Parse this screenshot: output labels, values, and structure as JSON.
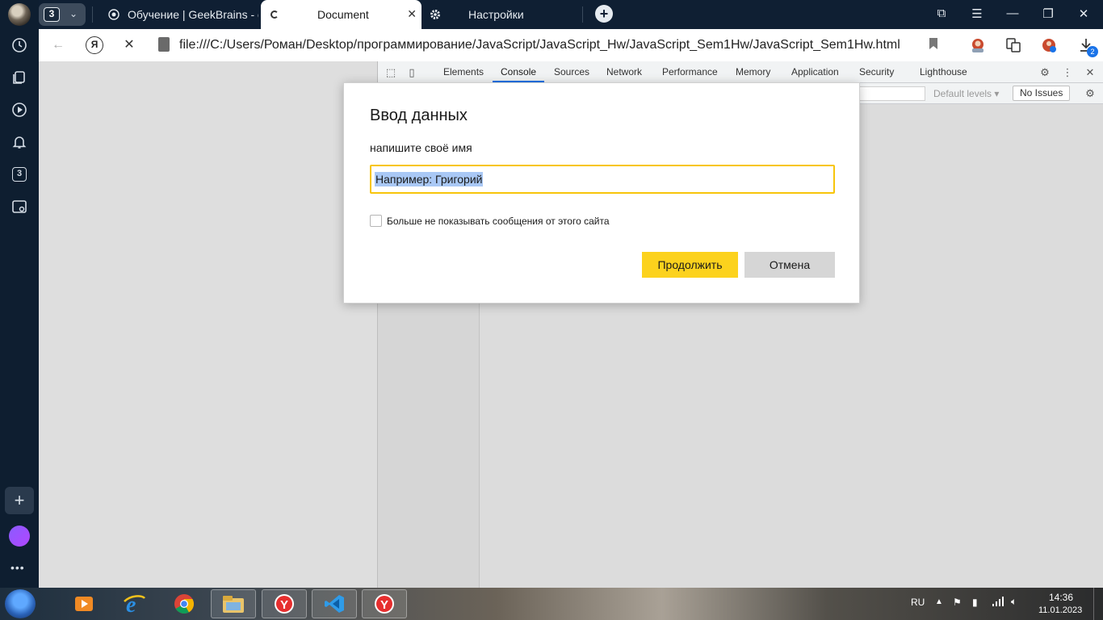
{
  "tabs": {
    "group_count": "3",
    "items": [
      {
        "label": "Обучение | GeekBrains - о"
      },
      {
        "label": "Document"
      },
      {
        "label": "Настройки"
      }
    ]
  },
  "address": {
    "url": "file:///C:/Users/Роман/Desktop/программирование/JavaScript/JavaScript_Hw/JavaScript_Sem1Hw/JavaScript_Sem1Hw.html",
    "yandex_button": "Я",
    "downloads_badge": "2"
  },
  "sidebar": {
    "counter_badge": "3"
  },
  "devtools": {
    "tabs": [
      "Elements",
      "Console",
      "Sources",
      "Network",
      "Performance",
      "Memory",
      "Application",
      "Security",
      "Lighthouse"
    ],
    "active_tab": "Console",
    "levels_label": "Default levels ▾",
    "issues_label": "No Issues"
  },
  "dialog": {
    "title": "Ввод данных",
    "message": "напишите своё имя",
    "input_value": "Например: Григорий",
    "checkbox_label": "Больше не показывать сообщения от этого сайта",
    "ok_label": "Продолжить",
    "cancel_label": "Отмена"
  },
  "taskbar": {
    "lang": "RU",
    "time": "14:36",
    "date": "11.01.2023"
  },
  "colors": {
    "accent_yellow": "#fcd21d",
    "input_border": "#f7c50b",
    "chrome_dark": "#0f1f33",
    "devtools_blue": "#1a73e8"
  }
}
